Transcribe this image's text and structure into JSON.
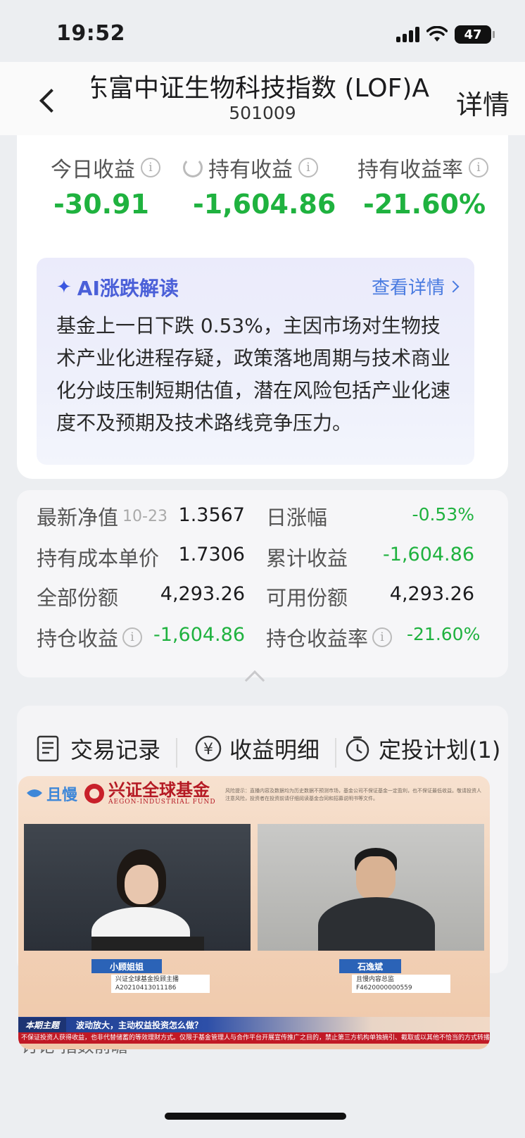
{
  "status_bar": {
    "time": "19:52",
    "battery": "47"
  },
  "header": {
    "fund_name": "东富中证生物科技指数 (LOF)A",
    "fund_code": "501009",
    "detail_label": "详情"
  },
  "profit_summary": {
    "today_label": "今日收益",
    "today_value": "-30.91",
    "holding_label": "持有收益",
    "holding_value": "-1,604.86",
    "rate_label": "持有收益率",
    "rate_value": "-21.60%"
  },
  "ai_section": {
    "title": "AI涨跌解读",
    "more_label": "查看详情",
    "text": "基金上一日下跌 0.53%，主因市场对生物技术产业化进程存疑，政策落地周期与技术商业化分歧压制短期估值，潜在风险包括产业化速度不及预期及技术路线竞争压力。"
  },
  "details": {
    "nav_label": "最新净值",
    "nav_date": "10-23",
    "nav_value": "1.3567",
    "daily_change_label": "日涨幅",
    "daily_change_value": "-0.53%",
    "cost_label": "持有成本单价",
    "cost_value": "1.7306",
    "cumulative_label": "累计收益",
    "cumulative_value": "-1,604.86",
    "total_shares_label": "全部份额",
    "total_shares_value": "4,293.26",
    "available_shares_label": "可用份额",
    "available_shares_value": "4,293.26",
    "position_profit_label": "持仓收益",
    "position_profit_value": "-1,604.86",
    "position_rate_label": "持仓收益率",
    "position_rate_value": "-21.60%"
  },
  "actions": {
    "records": "交易记录",
    "income_detail": "收益明细",
    "plan": "定投计划(1)"
  },
  "video": {
    "qiemo": "且慢",
    "brand": "兴证全球基金",
    "brand_en": "AEGON-INDUSTRIAL FUND",
    "risk_notice": "风险提示：直播内容及数据均为历史数据不预测市场，基金公司不保证基金一定盈利，也不保证最低收益。敬请投资人注意风险，投资者在投资前请仔细阅读基金合同和招募说明书等文件。",
    "host_left_name": "小顾姐姐",
    "host_left_title": "兴证全球基金投顾主播",
    "host_left_id": "A20210413011186",
    "host_right_name": "石逸斌",
    "host_right_title": "且慢内容总监",
    "host_right_id": "F4620000000559",
    "topic_tag": "本期主题",
    "topic": "波动放大，主动权益投资怎么做？",
    "ticker": "不保证投资人获得收益，也非代替储蓄的等效理财方式。仅限于基金管理人与合作平台开展宣传推广之目的，禁止第三方机构单独摘引、截取或以其他不恰当的方式转播，市场有风险，投资"
  },
  "behind_text": "讨论 指数前瞻"
}
